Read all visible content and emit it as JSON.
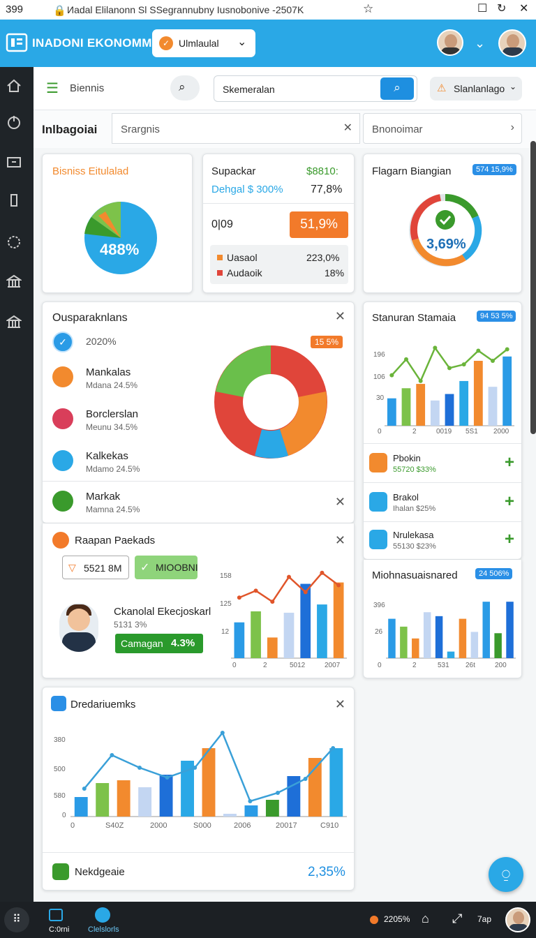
{
  "status": {
    "time": "399",
    "url": "Иadal Elilanonn Sl SSegrannubny Iusnobonive -2507K"
  },
  "app": {
    "brand": "INADONI EKONOMMI",
    "selector": "Ulmlaulal"
  },
  "toolbar": {
    "menu_label": "Biennis",
    "search_value": "Skemeralan",
    "alert_label": "Slanlanlago"
  },
  "tabsbar": {
    "title": "Inlbagoiai",
    "search_placeholder": "Srargnis",
    "filter_value": "Bnonoimar"
  },
  "card_business": {
    "title": "Bisniss Eitulalad",
    "pie_label": "488%"
  },
  "card_supplier": {
    "title": "Supackar",
    "value_top": "$8810:",
    "subtitle": "Dehgal $ 300%",
    "subtitle_value": "77,8%",
    "row_label": "0|09",
    "row_value": "51,9%",
    "items": [
      {
        "label": "Uasaol",
        "value": "223,0%",
        "color": "#f28a2e"
      },
      {
        "label": "Audaoik",
        "value": "18%",
        "color": "#e0453a"
      }
    ]
  },
  "card_target": {
    "title": "Flagarn Biangian",
    "badge": "574 15,9%",
    "gauge_value": "3,69%"
  },
  "card_ops": {
    "title": "Ousparaknlans",
    "badge": "15 5%",
    "items": [
      {
        "label": "2020%",
        "sub": "",
        "color": "#2a9be6"
      },
      {
        "label": "Mankalas",
        "sub": "Mdana 24.5%",
        "color": "#f28a2e"
      },
      {
        "label": "Borclerslan",
        "sub": "Meunu 34.5%",
        "color": "#d93e5a"
      },
      {
        "label": "Kalkekas",
        "sub": "Mdamo 24.5%",
        "color": "#2aa8e6"
      },
      {
        "label": "Markak",
        "sub": "Mamna 24.5%",
        "color": "#3a9a2c"
      }
    ]
  },
  "card_stats": {
    "title": "Stanuran Stamaia",
    "badge": "94 53 5%",
    "y_ticks": [
      "196",
      "106",
      "30"
    ],
    "x_ticks": [
      "0",
      "2",
      "0019",
      "5S1",
      "2000"
    ]
  },
  "card_list": {
    "items": [
      {
        "label": "Pbokin",
        "sub": "55720 $33%",
        "color": "#f28a2e"
      },
      {
        "label": "Brakol",
        "sub": "Ihalan $25%",
        "color": "#2aa8e6"
      },
      {
        "label": "Nrulekasa",
        "sub": "55130 $23%",
        "color": "#2aa8e6"
      }
    ]
  },
  "card_recent": {
    "title": "Raapan Paekads",
    "amount": "5521 8M",
    "status": "MIOOBNI",
    "person_name": "Ckanolal Ekecjoskarl",
    "person_sub": "5131 3%",
    "campaign_label": "Camagan",
    "campaign_value": "4.3%",
    "y_ticks": [
      "158",
      "125",
      "12"
    ],
    "x_ticks": [
      "0",
      "2",
      "5012",
      "2007"
    ]
  },
  "card_mio": {
    "title": "Miohnasuaisnared",
    "badge": "24 506%",
    "y_ticks": [
      "396",
      "26"
    ],
    "x_ticks": [
      "0",
      "2",
      "531",
      "26t",
      "200"
    ]
  },
  "card_dred": {
    "title": "Dredariuemks",
    "y_ticks": [
      "380",
      "500",
      "580",
      "0"
    ],
    "x_ticks": [
      "0",
      "S40Z",
      "2000",
      "S000",
      "2006",
      "20017",
      "C910"
    ],
    "footer_label": "Nekdgeaie",
    "footer_value": "2,35%"
  },
  "bottomnav": {
    "tab1": "C:0rni",
    "tab2": "Clelslorls",
    "notif": "2205%",
    "extra": "7ap"
  },
  "chart_data": [
    {
      "type": "bar",
      "title": "Stanuran Stamaia",
      "series": [
        {
          "name": "",
          "values": [
            38,
            52,
            58,
            35,
            44,
            62,
            90,
            54,
            96
          ]
        }
      ],
      "line": [
        70,
        92,
        62,
        108,
        80,
        85,
        104,
        90,
        106
      ],
      "ylim": [
        0,
        120
      ]
    },
    {
      "type": "bar",
      "title": "Raapan Paekads",
      "series": [
        {
          "name": "",
          "values": [
            52,
            68,
            30,
            66,
            108,
            78,
            110
          ]
        }
      ],
      "line": [
        88,
        98,
        82,
        118,
        96,
        124,
        106
      ],
      "ylim": [
        0,
        140
      ]
    },
    {
      "type": "bar",
      "title": "Miohnasuaisnared",
      "series": [
        {
          "name": "",
          "values": [
            60,
            48,
            30,
            70,
            64,
            10,
            60,
            40,
            86,
            38,
            86
          ]
        }
      ],
      "ylim": [
        0,
        100
      ]
    },
    {
      "type": "bar",
      "title": "Dredariuemks",
      "series": [
        {
          "name": "",
          "values": [
            28,
            48,
            52,
            42,
            60,
            80,
            98,
            4,
            16,
            24,
            58,
            84,
            98
          ]
        }
      ],
      "line": [
        40,
        88,
        70,
        56,
        70,
        120,
        22,
        34,
        54,
        98
      ],
      "ylim": [
        0,
        130
      ]
    }
  ]
}
